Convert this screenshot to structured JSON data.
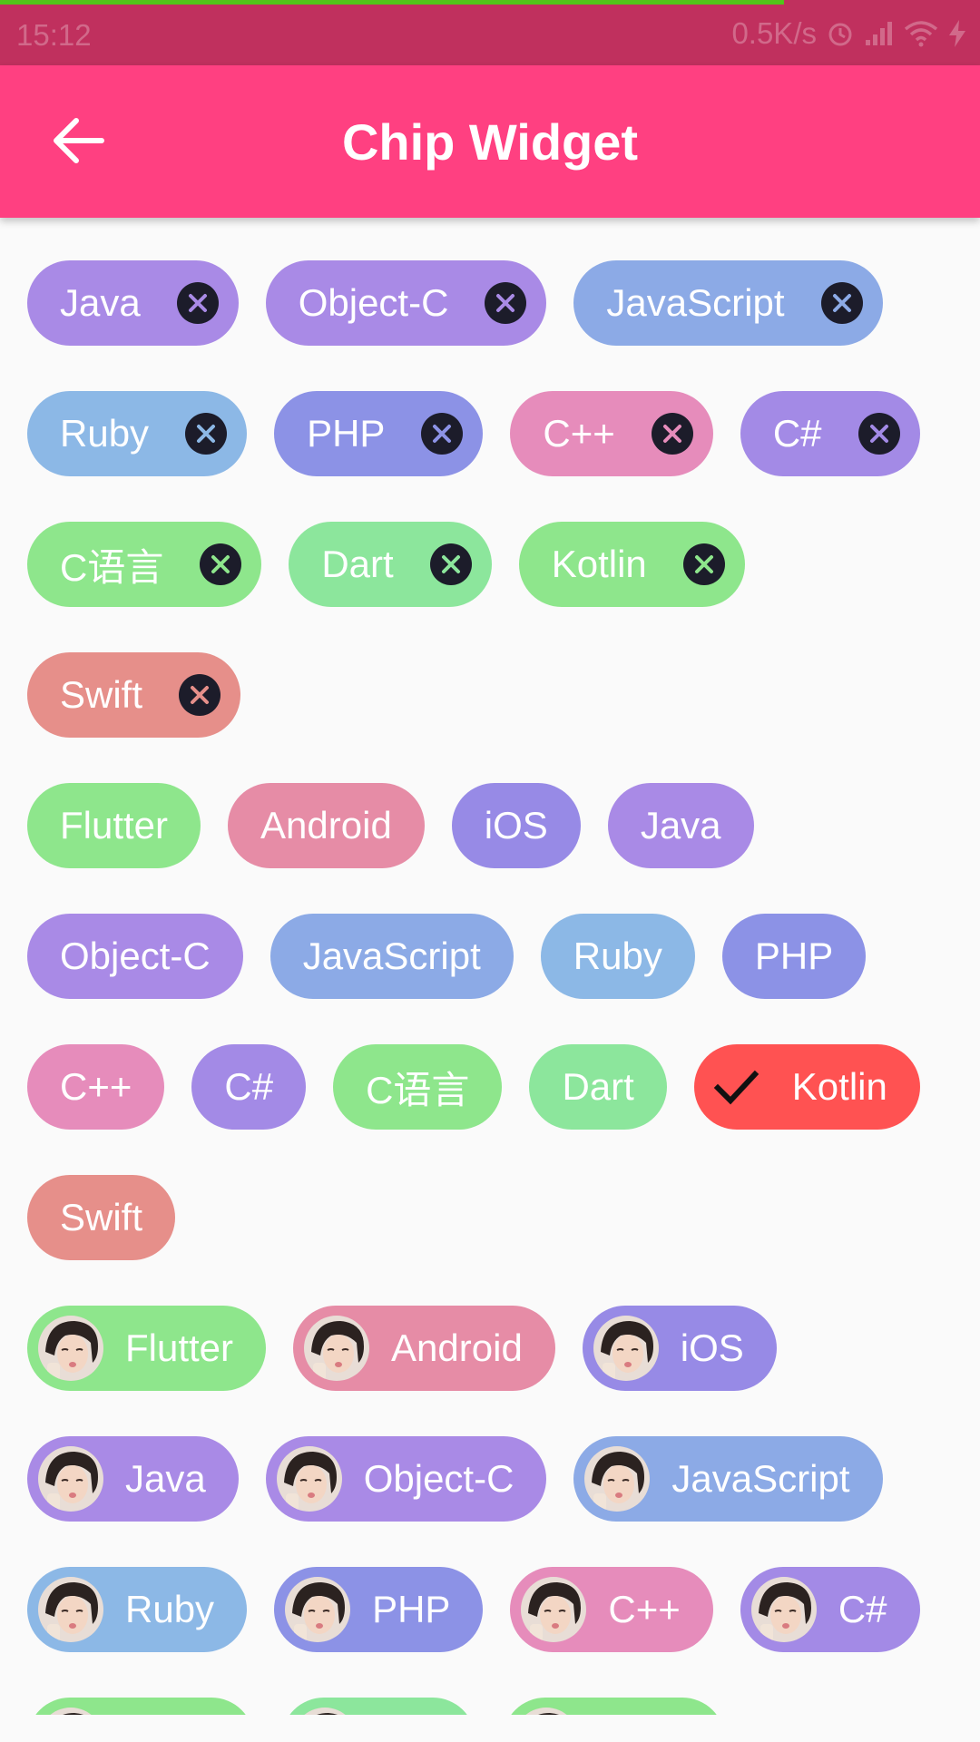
{
  "status_bar": {
    "time": "15:12",
    "speed": "0.5K/s"
  },
  "app_bar": {
    "title": "Chip Widget"
  },
  "colors": {
    "appbar": "#ff4081",
    "statusbar": "#c0305e",
    "selected": "#ff5252",
    "palette": {
      "purple": "#a98ae6",
      "blue": "#8caae6",
      "lightblue": "#8cb8e6",
      "indigo": "#8c92e6",
      "pink": "#e68cbb",
      "violet": "#a38ae6",
      "green": "#8ee68c",
      "mint": "#8ce69c",
      "rose": "#e68ca6",
      "salmon": "#e68f8a",
      "iosblue": "#978ae6"
    }
  },
  "deletable_chips": [
    [
      {
        "label": "Java",
        "color": "purple"
      },
      {
        "label": "Object-C",
        "color": "purple"
      },
      {
        "label": "JavaScript",
        "color": "blue"
      }
    ],
    [
      {
        "label": "Ruby",
        "color": "lightblue"
      },
      {
        "label": "PHP",
        "color": "indigo"
      },
      {
        "label": "C++",
        "color": "pink"
      },
      {
        "label": "C#",
        "color": "violet"
      }
    ],
    [
      {
        "label": "C语言",
        "color": "green"
      },
      {
        "label": "Dart",
        "color": "mint"
      },
      {
        "label": "Kotlin",
        "color": "green"
      }
    ],
    [
      {
        "label": "Swift",
        "color": "salmon"
      }
    ]
  ],
  "choice_chips": [
    [
      {
        "label": "Flutter",
        "color": "green"
      },
      {
        "label": "Android",
        "color": "rose"
      },
      {
        "label": "iOS",
        "color": "iosblue"
      },
      {
        "label": "Java",
        "color": "purple"
      }
    ],
    [
      {
        "label": "Object-C",
        "color": "purple"
      },
      {
        "label": "JavaScript",
        "color": "blue"
      },
      {
        "label": "Ruby",
        "color": "lightblue"
      },
      {
        "label": "PHP",
        "color": "indigo"
      }
    ],
    [
      {
        "label": "C++",
        "color": "pink"
      },
      {
        "label": "C#",
        "color": "violet"
      },
      {
        "label": "C语言",
        "color": "green"
      },
      {
        "label": "Dart",
        "color": "mint"
      },
      {
        "label": "Kotlin",
        "color": "selected",
        "selected": true
      }
    ],
    [
      {
        "label": "Swift",
        "color": "salmon"
      }
    ]
  ],
  "avatar_chips": [
    [
      {
        "label": "Flutter",
        "color": "green"
      },
      {
        "label": "Android",
        "color": "rose"
      },
      {
        "label": "iOS",
        "color": "iosblue"
      }
    ],
    [
      {
        "label": "Java",
        "color": "purple"
      },
      {
        "label": "Object-C",
        "color": "purple"
      },
      {
        "label": "JavaScript",
        "color": "blue"
      }
    ],
    [
      {
        "label": "Ruby",
        "color": "lightblue"
      },
      {
        "label": "PHP",
        "color": "indigo"
      },
      {
        "label": "C++",
        "color": "pink"
      },
      {
        "label": "C#",
        "color": "violet"
      }
    ],
    [
      {
        "label": "",
        "color": "green"
      },
      {
        "label": "",
        "color": "mint"
      },
      {
        "label": "",
        "color": "green"
      }
    ]
  ]
}
